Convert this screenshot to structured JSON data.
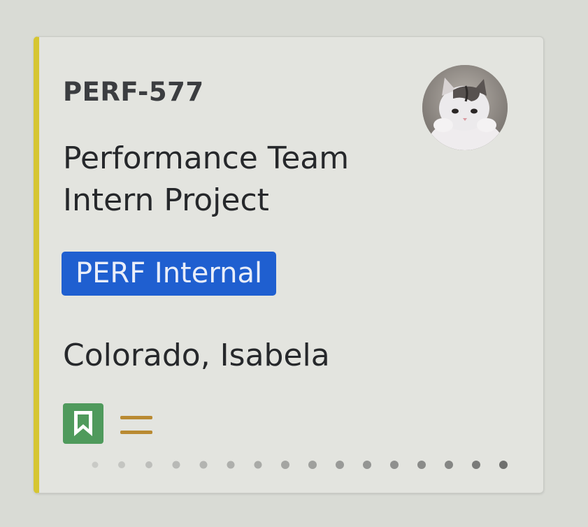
{
  "card": {
    "issue_key": "PERF-577",
    "summary": "Performance Team Intern Project",
    "label": "PERF Internal",
    "assignee": "Colorado, Isabela",
    "avatar_icon": "cat-avatar-icon",
    "type_icon": "bookmark-story-icon",
    "priority_icon": "equals-medium-priority-icon",
    "colors": {
      "left_stripe": "#d6c632",
      "label_bg": "#1f5fd0",
      "type_icon_bg": "#4f9a5c",
      "priority_color": "#b98a32"
    }
  }
}
